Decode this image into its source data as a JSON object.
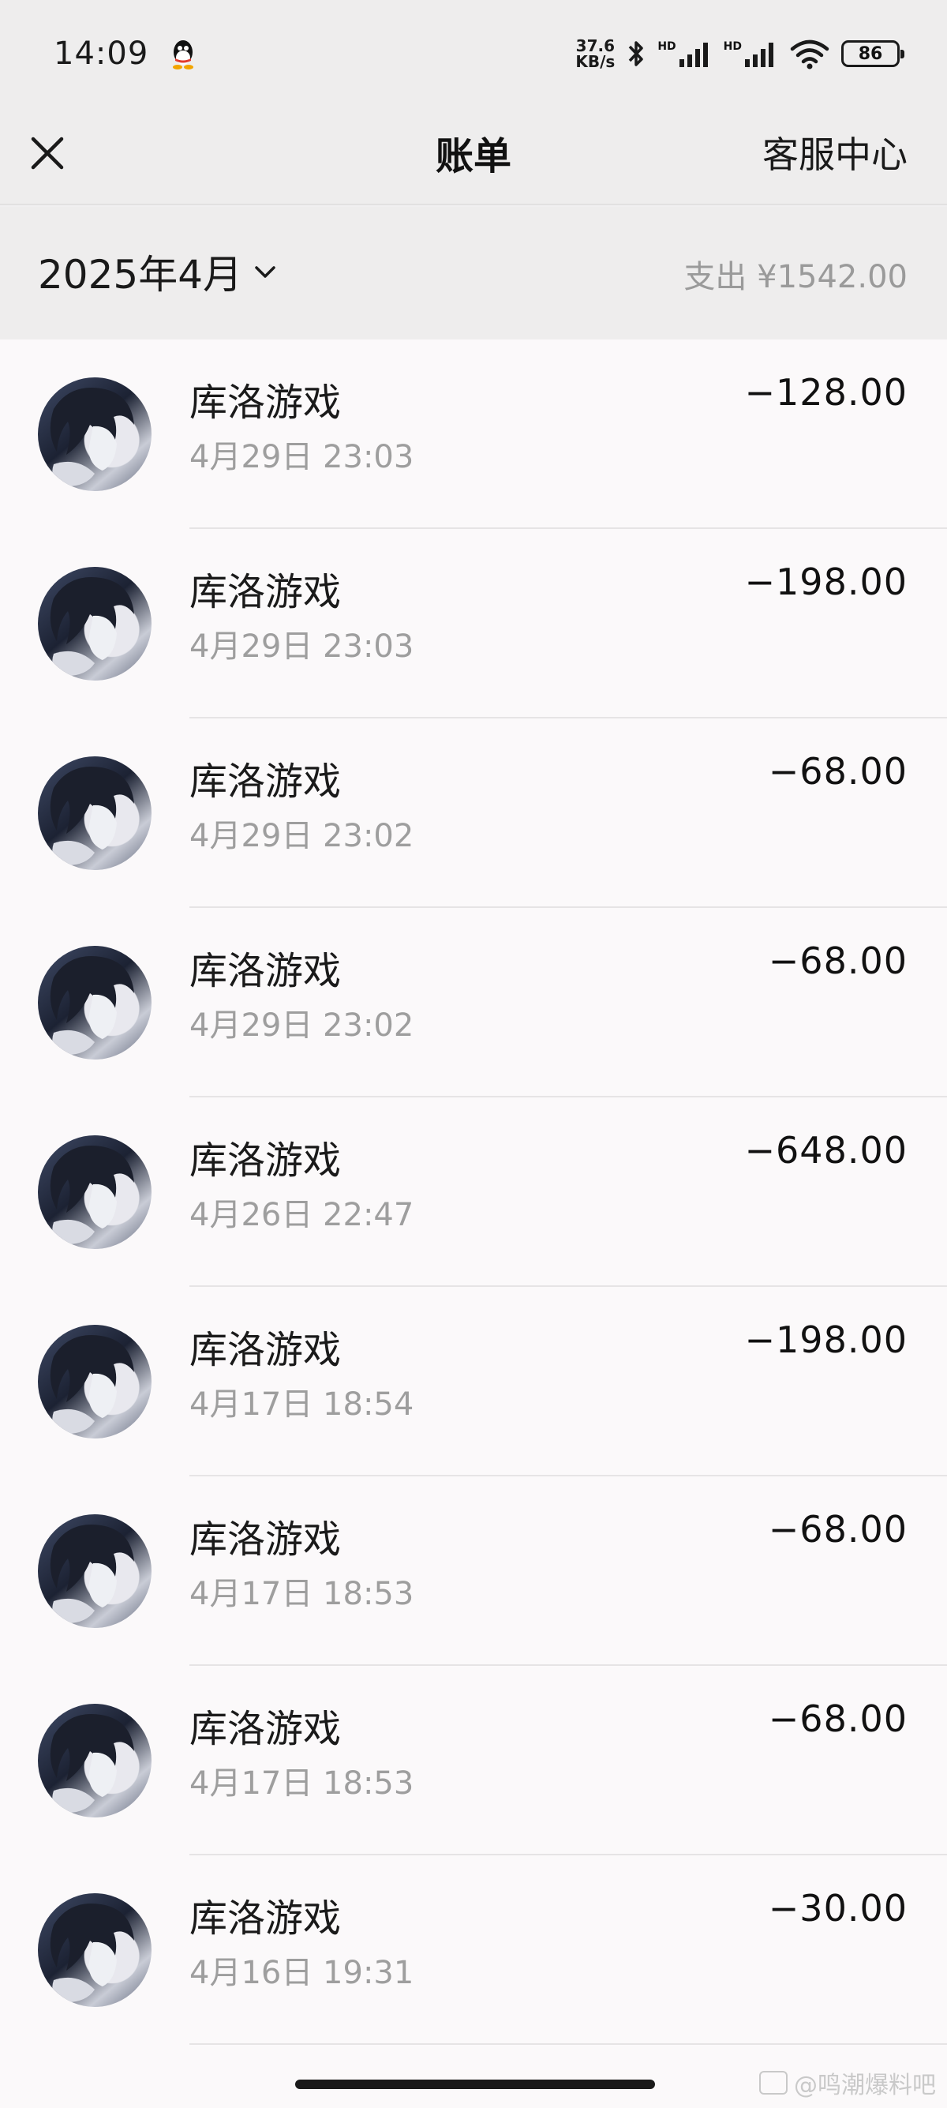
{
  "status_bar": {
    "time": "14:09",
    "net_speed_value": "37.6",
    "net_speed_unit": "KB/s",
    "signal1_label": "HD",
    "signal2_label": "HD",
    "battery": "86",
    "icons": [
      "qq-icon",
      "bluetooth-icon",
      "signal-icon",
      "wifi-icon",
      "battery-icon"
    ]
  },
  "nav": {
    "title": "账单",
    "right_link": "客服中心",
    "close_icon": "close-icon"
  },
  "summary": {
    "month": "2025年4月",
    "expense": "支出 ¥1542.00",
    "chevron_icon": "chevron-down-icon"
  },
  "bills": [
    {
      "merchant": "库洛游戏",
      "time": "4月29日 23:03",
      "amount": "−128.00"
    },
    {
      "merchant": "库洛游戏",
      "time": "4月29日 23:03",
      "amount": "−198.00"
    },
    {
      "merchant": "库洛游戏",
      "time": "4月29日 23:02",
      "amount": "−68.00"
    },
    {
      "merchant": "库洛游戏",
      "time": "4月29日 23:02",
      "amount": "−68.00"
    },
    {
      "merchant": "库洛游戏",
      "time": "4月26日 22:47",
      "amount": "−648.00"
    },
    {
      "merchant": "库洛游戏",
      "time": "4月17日 18:54",
      "amount": "−198.00"
    },
    {
      "merchant": "库洛游戏",
      "time": "4月17日 18:53",
      "amount": "−68.00"
    },
    {
      "merchant": "库洛游戏",
      "time": "4月17日 18:53",
      "amount": "−68.00"
    },
    {
      "merchant": "库洛游戏",
      "time": "4月16日 19:31",
      "amount": "−30.00"
    }
  ],
  "watermark": "@鸣潮爆料吧",
  "colors": {
    "page_bg": "#eeeded",
    "list_bg": "#fbf9fa",
    "secondary_text": "#9e9e9e"
  }
}
